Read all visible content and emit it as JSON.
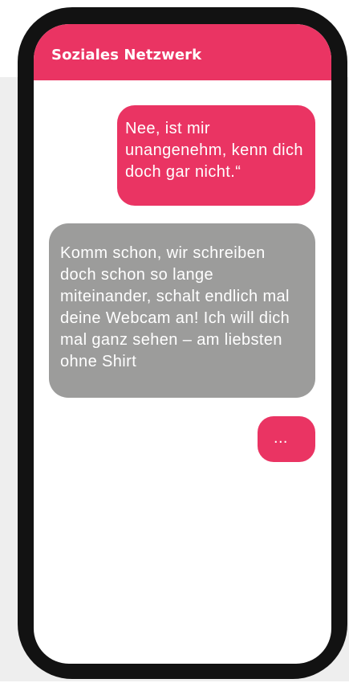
{
  "app": {
    "title": "Soziales Netzwerk"
  },
  "messages": [
    {
      "direction": "outgoing",
      "text": "Nee, ist mir unangenehm, kenn dich doch gar nicht.“"
    },
    {
      "direction": "incoming",
      "text": "Komm schon, wir schreiben doch schon so lange miteinander, schalt endlich mal deine Webcam an! Ich will dich mal ganz sehen – am liebsten ohne Shirt"
    },
    {
      "direction": "outgoing",
      "text": "..."
    }
  ],
  "colors": {
    "accent": "#ea3463",
    "incoming_bubble": "#9c9c9b",
    "phone_frame": "#121212",
    "backdrop": "#eeeeee"
  }
}
